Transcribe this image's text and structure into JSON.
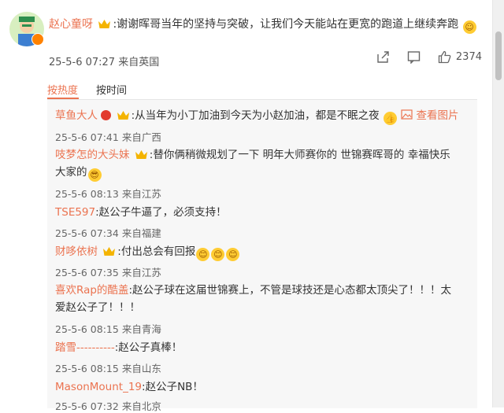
{
  "main_comment": {
    "username": "赵心童呀",
    "text": ":谢谢晖哥当年的坚持与突破，让我们今天能站在更宽的跑道上继续奔跑",
    "timestamp": "25-5-6 07:27",
    "location": "来自英国",
    "like_count": "2374"
  },
  "tabs": {
    "hot": "按热度",
    "time": "按时间"
  },
  "replies": [
    {
      "username": "草鱼大人",
      "text": ":从当年为小丁加油到今天为小赵加油，都是不眠之夜",
      "view_image": "查看图片",
      "timestamp": "25-5-6 07:41",
      "location": "来自广西"
    },
    {
      "username": "吱梦怎的大头妹",
      "text": ":替你俩稍微规划了一下 明年大师赛你的  世锦赛晖哥的 幸福快乐",
      "text2": "大家的",
      "timestamp": "25-5-6 08:13",
      "location": "来自江苏"
    },
    {
      "username": "TSE597",
      "text": ":赵公子牛逼了，必须支持！",
      "timestamp": "25-5-6 07:34",
      "location": "来自福建"
    },
    {
      "username": "财哆依树",
      "text": ":付出总会有回报",
      "timestamp": "25-5-6 07:35",
      "location": "来自江苏"
    },
    {
      "username": "喜欢Rap的酷盖",
      "text": ":赵公子球在这届世锦赛上，不管是球技还是心态都太顶尖了！！！太",
      "text2": "爱赵公子了！！！",
      "timestamp": "25-5-6 08:15",
      "location": "来自青海"
    },
    {
      "username": "踏雪----------",
      "text": ":赵公子真棒！",
      "timestamp": "25-5-6 08:15",
      "location": "来自山东"
    },
    {
      "username": "MasonMount_19",
      "text": ":赵公子NB！",
      "timestamp": "25-5-6 07:32",
      "location": "来自北京"
    }
  ],
  "colors": {
    "accent": "#eb7350",
    "box_bg": "#f7f7f7"
  },
  "icons": [
    "share-icon",
    "comment-icon",
    "like-icon",
    "crown-icon",
    "image-icon"
  ]
}
